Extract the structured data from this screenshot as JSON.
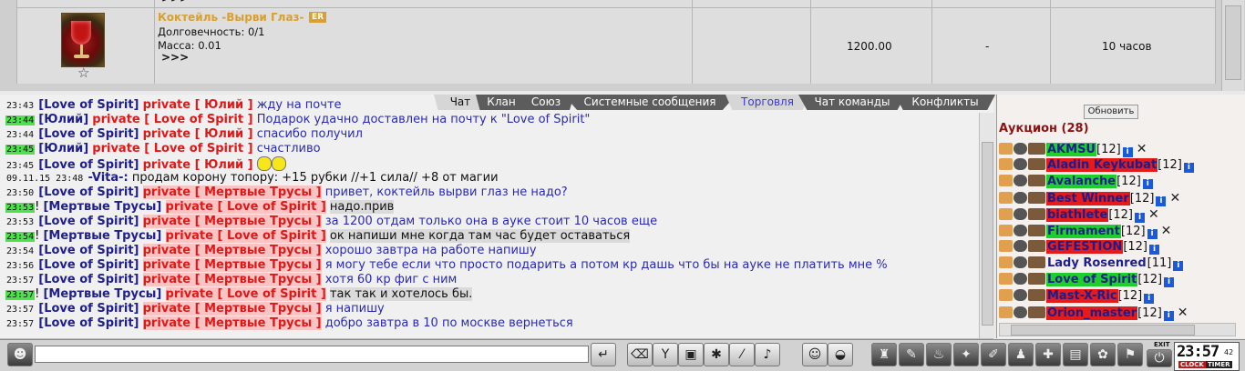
{
  "item": {
    "top_more": ">>>",
    "name": "Коктейль -Вырви Глаз-",
    "badge": "ER",
    "durability": "Долговечность: 0/1",
    "mass": "Масса: 0.01",
    "more": ">>>",
    "price": "1200.00",
    "dash": "-",
    "time_left": "10 часов",
    "fav_icon": "star-icon"
  },
  "chat": {
    "tabs": [
      {
        "label": "Чат"
      },
      {
        "label": "Клан"
      },
      {
        "label": "Союз"
      },
      {
        "label": "Системные сообщения"
      },
      {
        "label": "Торговля"
      },
      {
        "label": "Чат команды"
      },
      {
        "label": "Конфликты"
      }
    ],
    "lines": [
      {
        "time": "23:43",
        "a": "[Love of Spirit]",
        "p": "private [ Юлий ]",
        "m": "жду на почте"
      },
      {
        "time": "23:44",
        "a": "[Юлий]",
        "p": "private [ Love of Spirit ]",
        "m": "Подарок удачно доставлен на почту к \"Love of Spirit\""
      },
      {
        "time": "23:44",
        "a": "[Love of Spirit]",
        "p": "private [ Юлий ]",
        "m": "спасибо получил"
      },
      {
        "time": "23:45",
        "a": "[Юлий]",
        "p": "private [ Love of Spirit ]",
        "m": "счастливо"
      },
      {
        "time": "23:45",
        "a": "[Love of Spirit]",
        "p": "private [ Юлий ]",
        "m": ""
      },
      {
        "time": "09.11.15 23:48",
        "a": "-Vita-:",
        "p": "",
        "m": "продам корону топору: +15 рубки //+1 сила// +8 от магии"
      },
      {
        "time": "23:50",
        "a": "[Love of Spirit]",
        "p": "private [ Мертвые Трусы ]",
        "m": "привет, коктейль вырви глаз не надо?"
      },
      {
        "time": "23:53",
        "a": "[Мертвые Трусы]",
        "p": "private [ Love of Spirit ]",
        "m": "надо.прив"
      },
      {
        "time": "23:53",
        "a": "[Love of Spirit]",
        "p": "private [ Мертвые Трусы ]",
        "m": "за 1200 отдам только она в ауке стоит 10 часов еще"
      },
      {
        "time": "23:54",
        "a": "[Мертвые Трусы]",
        "p": "private [ Love of Spirit ]",
        "m": "ок напиши мне когда там час будет оставаться"
      },
      {
        "time": "23:54",
        "a": "[Love of Spirit]",
        "p": "private [ Мертвые Трусы ]",
        "m": "хорошо завтра на работе напишу"
      },
      {
        "time": "23:56",
        "a": "[Love of Spirit]",
        "p": "private [ Мертвые Трусы ]",
        "m": "я могу тебе если что просто подарить а потом кр дашь что бы на ауке не платить мне %"
      },
      {
        "time": "23:57",
        "a": "[Love of Spirit]",
        "p": "private [ Мертвые Трусы ]",
        "m": "хотя 60 кр фиг с ним"
      },
      {
        "time": "23:57",
        "a": "[Мертвые Трусы]",
        "p": "private [ Love of Spirit ]",
        "m": "так так и хотелось бы."
      },
      {
        "time": "23:57",
        "a": "[Love of Spirit]",
        "p": "private [ Мертвые Трусы ]",
        "m": "я напишу"
      },
      {
        "time": "23:57",
        "a": "[Love of Spirit]",
        "p": "private [ Мертвые Трусы ]",
        "m": "добро завтра в 10 по москве вернеться"
      }
    ]
  },
  "auction": {
    "refresh": "Обновить",
    "title": "Аукцион (28)",
    "players": [
      {
        "name": "AKMSU",
        "level": "[12]"
      },
      {
        "name": "Aladin Keykubat",
        "level": "[12]"
      },
      {
        "name": "Avalanche",
        "level": "[12]"
      },
      {
        "name": "Best Winner",
        "level": "[12]"
      },
      {
        "name": "biathlete",
        "level": "[12]"
      },
      {
        "name": "Firmament",
        "level": "[12]"
      },
      {
        "name": "GEFESTION",
        "level": "[12]"
      },
      {
        "name": "Lady Rosenred",
        "level": "[11]"
      },
      {
        "name": "Love of Spirit",
        "level": "[12]"
      },
      {
        "name": "Mast-X-Ric",
        "level": "[12]"
      },
      {
        "name": "Orion_master",
        "level": "[12]"
      }
    ]
  },
  "bottom": {
    "exit": "EXIT",
    "clock_time": "23:57",
    "clock_sec": "42",
    "clock_label": "CLOCK",
    "timer_label": "TIMER"
  }
}
